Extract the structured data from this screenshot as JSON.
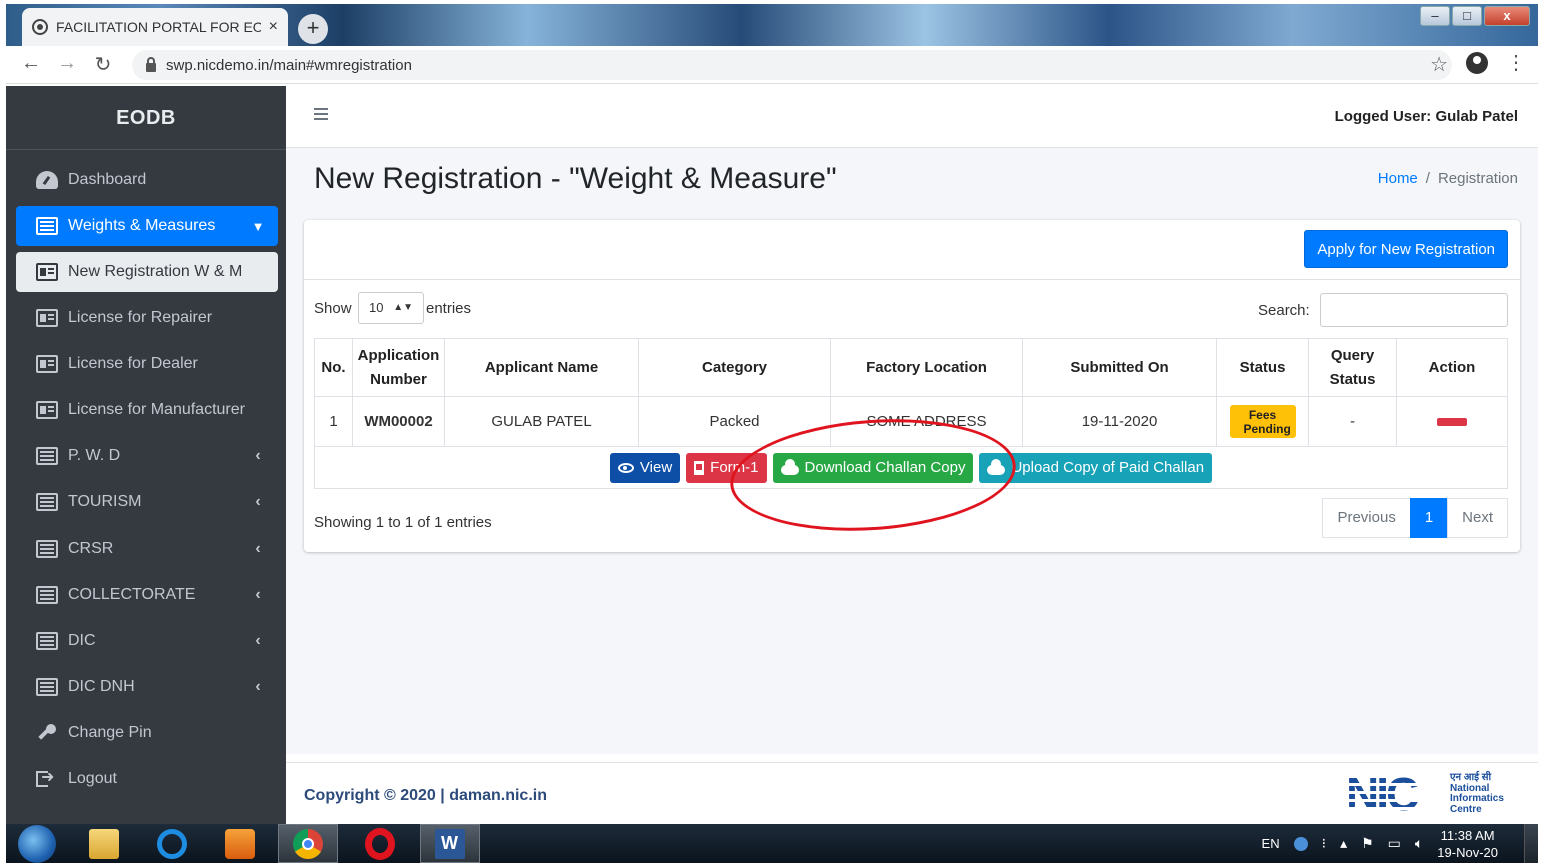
{
  "browser": {
    "tab_title": "FACILITATION PORTAL FOR EOD",
    "tab_close": "×",
    "new_tab": "+",
    "url": "swp.nicdemo.in/main#wmregistration",
    "window_controls": [
      "–",
      "□",
      "x"
    ]
  },
  "sidebar": {
    "brand": "EODB",
    "items": [
      {
        "label": "Dashboard",
        "icon": "dashboard-icon"
      },
      {
        "label": "Weights & Measures",
        "icon": "list-icon",
        "expanded": true
      },
      {
        "label": "New Registration W & M",
        "icon": "id-card-icon"
      },
      {
        "label": "License for Repairer",
        "icon": "id-card-icon"
      },
      {
        "label": "License for Dealer",
        "icon": "id-card-icon"
      },
      {
        "label": "License for Manufacturer",
        "icon": "id-card-icon"
      },
      {
        "label": "P. W. D",
        "icon": "list-icon"
      },
      {
        "label": "TOURISM",
        "icon": "list-icon"
      },
      {
        "label": "CRSR",
        "icon": "list-icon"
      },
      {
        "label": "COLLECTORATE",
        "icon": "list-icon"
      },
      {
        "label": "DIC",
        "icon": "list-icon"
      },
      {
        "label": "DIC DNH",
        "icon": "list-icon"
      },
      {
        "label": "Change Pin",
        "icon": "key-icon"
      },
      {
        "label": "Logout",
        "icon": "sign-out-icon"
      }
    ]
  },
  "header": {
    "logged_user": "Logged User: Gulab Patel"
  },
  "page": {
    "title": "New Registration - \"Weight & Measure\"",
    "breadcrumb": {
      "home": "Home",
      "separator": "/",
      "current": "Registration"
    }
  },
  "card": {
    "apply_button": "Apply for New Registration",
    "show_label": "Show",
    "entries_value": "10",
    "entries_label": "entries",
    "search_label": "Search:",
    "table": {
      "headers": [
        "No.",
        "Application Number",
        "Applicant Name",
        "Category",
        "Factory Location",
        "Submitted On",
        "Status",
        "Query Status",
        "Action"
      ],
      "rows": [
        {
          "no": "1",
          "app_number": "WM00002",
          "applicant": "GULAB PATEL",
          "category": "Packed",
          "location": "SOME ADDRESS",
          "submitted": "19-11-2020",
          "status": "Fees Pending",
          "query_status": "-"
        }
      ]
    },
    "row_actions": {
      "view": "View",
      "form": "Form-1",
      "download": "Download Challan Copy",
      "upload": "Upload Copy of Paid Challan"
    },
    "showing": "Showing 1 to 1 of 1 entries",
    "pagination": {
      "previous": "Previous",
      "current": "1",
      "next": "Next"
    }
  },
  "footer": {
    "copyright": "Copyright © 2020 | daman.nic.in",
    "logo_text": "NIC",
    "logo_caption": "एन आई सी National Informatics Centre"
  },
  "taskbar": {
    "lang": "EN",
    "time": "11:38 AM",
    "date": "19-Nov-20"
  },
  "colors": {
    "sidebar_bg": "#343a40",
    "primary": "#007bff",
    "success": "#28a745",
    "danger": "#dc3545",
    "info": "#17a2b8",
    "warning": "#ffc107",
    "annotation": "#e0141e"
  }
}
